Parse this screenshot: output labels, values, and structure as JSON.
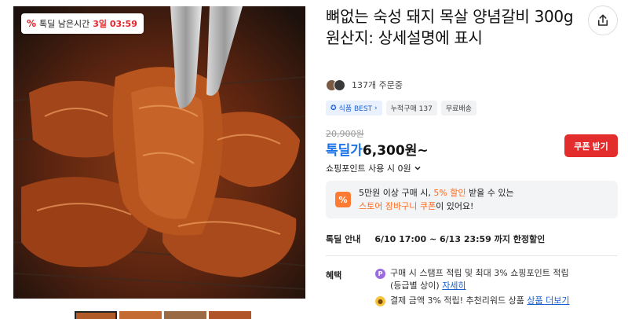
{
  "image": {
    "timer_badge": {
      "label": "톡딜 남은시간",
      "time": "3일 03:59"
    }
  },
  "product": {
    "title": "뼈없는 숙성 돼지 목살 양념갈비 300g 원산지: 상세설명에 표시"
  },
  "orders": {
    "text": "137개 주문중"
  },
  "badges": [
    "식품 BEST",
    "누적구매 137",
    "무료배송"
  ],
  "price": {
    "original": "20,900원",
    "sale_label": "톡딜가",
    "sale_amount": "6,300원~",
    "coupon_button": "쿠폰 받기",
    "points_text": "쇼핑포인트 사용 시 0원"
  },
  "promo": {
    "line1_pre": "5만원 이상 구매 시,",
    "line1_hl": "5% 할인",
    "line1_post": "받을 수 있는",
    "line2_hl": "스토어 장바구니 쿠폰",
    "line2_post": "이 있어요!"
  },
  "sale_info": {
    "label": "톡딜 안내",
    "value": "6/10 17:00 ~ 6/13 23:59 까지 한정할인"
  },
  "benefits": {
    "title": "혜택",
    "item1_text": "구매 시 스탬프 적립 및 최대 3% 쇼핑포인트 적립",
    "item1_sub": "(등급별 상이)",
    "item1_link": "자세히",
    "item2_text": "결제 금액 3% 적립! 추천리워드 상품",
    "item2_link": "상품 더보기"
  },
  "colors": {
    "accent_blue": "#1a73e8",
    "coupon_red": "#e32c2c",
    "highlight_orange": "#ff6a1f"
  }
}
